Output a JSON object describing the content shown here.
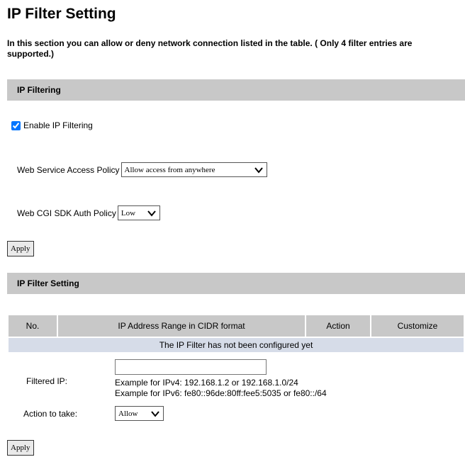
{
  "page": {
    "title": "IP Filter Setting",
    "intro": "In this section you can allow or deny network connection listed in the table. ( Only 4 filter entries are supported.)"
  },
  "ip_filtering": {
    "header": "IP Filtering",
    "enable_label": "Enable IP Filtering",
    "enable_checked": true,
    "web_service_label": "Web Service Access Policy",
    "web_service_value": "Allow access from anywhere",
    "cgi_label": "Web CGI SDK Auth Policy",
    "cgi_value": "Low",
    "apply_label": "Apply"
  },
  "ip_filter_setting": {
    "header": "IP Filter Setting",
    "columns": [
      "No.",
      "IP Address Range in CIDR format",
      "Action",
      "Customize"
    ],
    "empty_message": "The IP Filter has not been configured yet",
    "filtered_ip_label": "Filtered IP:",
    "filtered_ip_value": "",
    "example_ipv4": "Example for IPv4: 192.168.1.2 or 192.168.1.0/24",
    "example_ipv6": "Example for IPv6: fe80::96de:80ff:fee5:5035 or fe80::/64",
    "action_label": "Action to take:",
    "action_value": "Allow",
    "apply_label": "Apply"
  },
  "icons": {
    "dropdown": "chevron-down-icon",
    "checkbox": "checkbox-checked"
  }
}
